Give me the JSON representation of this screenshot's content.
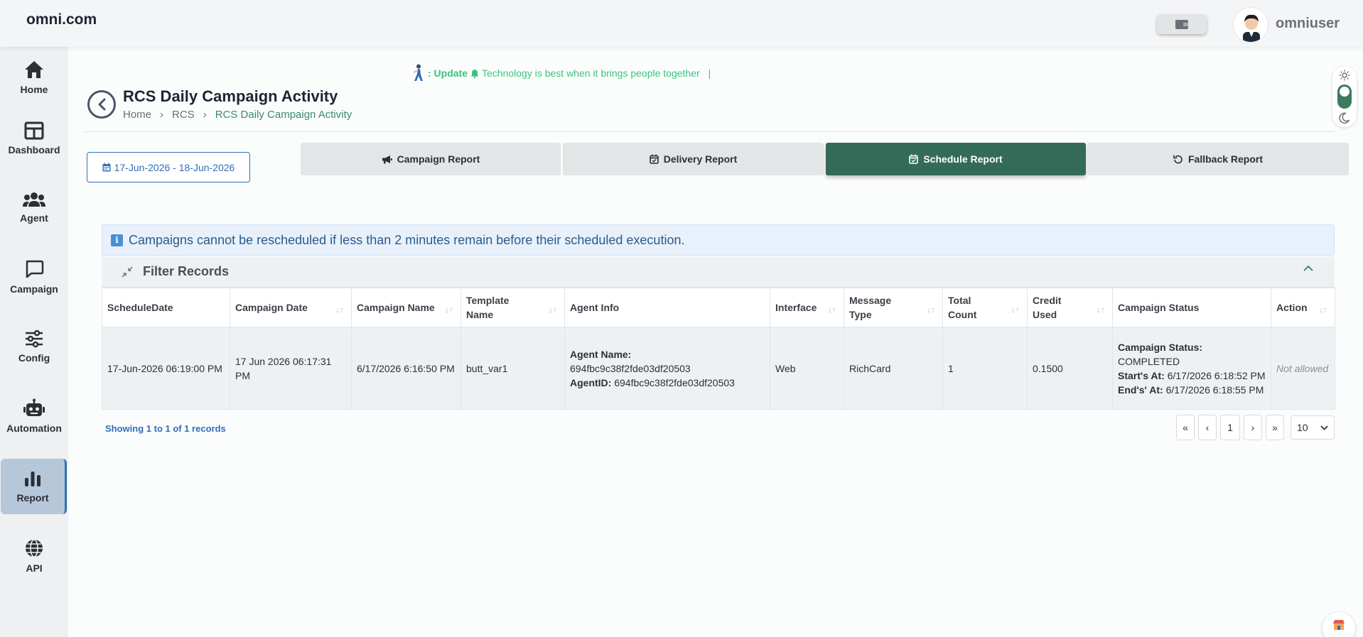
{
  "brand": "omni.com",
  "user": {
    "name": "omniuser"
  },
  "sidebar": {
    "items": [
      {
        "label": "Home",
        "icon": "home-icon"
      },
      {
        "label": "Dashboard",
        "icon": "dashboard-icon"
      },
      {
        "label": "Agent",
        "icon": "users-icon"
      },
      {
        "label": "Campaign",
        "icon": "chat-icon"
      },
      {
        "label": "Config",
        "icon": "sliders-icon"
      },
      {
        "label": "Automation",
        "icon": "robot-icon"
      },
      {
        "label": "Report",
        "icon": "bar-chart-icon",
        "active": true
      },
      {
        "label": "API",
        "icon": "globe-icon"
      }
    ]
  },
  "announcement": {
    "prefix": ": Update",
    "message": "Technology is best when it brings people together",
    "cursor": "|"
  },
  "page": {
    "title": "RCS Daily Campaign Activity",
    "breadcrumb": [
      "Home",
      "RCS",
      "RCS Daily Campaign Activity"
    ],
    "breadcrumb_sep": "›"
  },
  "date_range": "17-Jun-2026 - 18-Jun-2026",
  "tabs": [
    {
      "label": "Campaign Report",
      "icon": "megaphone-icon"
    },
    {
      "label": "Delivery Report",
      "icon": "calendar-check-icon"
    },
    {
      "label": "Schedule Report",
      "icon": "calendar-check-icon",
      "active": true
    },
    {
      "label": "Fallback Report",
      "icon": "undo-icon"
    }
  ],
  "alert": {
    "icon": "i",
    "text": "Campaigns cannot be rescheduled if less than 2 minutes remain before their scheduled execution."
  },
  "filter": {
    "title": "Filter Records"
  },
  "table": {
    "columns": [
      "ScheduleDate",
      "Campaign Date",
      "Campaign Name",
      "Template Name",
      "Agent Info",
      "Interface",
      "Message Type",
      "Total Count",
      "Credit Used",
      "Campaign Status",
      "Action"
    ],
    "sort_glyph": "↓↑",
    "rows": [
      {
        "schedule_date": "17-Jun-2026 06:19:00 PM",
        "campaign_date": "17 Jun 2026 06:17:31 PM",
        "campaign_name": "6/17/2026 6:16:50 PM",
        "template_name": "butt_var1",
        "agent_name_label": "Agent Name:",
        "agent_name": "694fbc9c38f2fde03df20503",
        "agent_id_label": "AgentID:",
        "agent_id": "694fbc9c38f2fde03df20503",
        "interface": "Web",
        "message_type": "RichCard",
        "total_count": "1",
        "credit_used": "0.1500",
        "status_label": "Campaign Status:",
        "status": "COMPLETED",
        "start_label": "Start's At:",
        "start": "6/17/2026 6:18:52 PM",
        "end_label": "End's' At:",
        "end": "6/17/2026 6:18:55 PM",
        "action": "Not allowed"
      }
    ]
  },
  "records_info": "Showing 1 to 1 of 1 records",
  "pagination": {
    "first": "«",
    "prev": "‹",
    "current": "1",
    "next": "›",
    "last": "»"
  },
  "page_size": "10",
  "colors": {
    "accent": "#346b58",
    "link": "#2f6fb8",
    "announce": "#3cc27a"
  }
}
